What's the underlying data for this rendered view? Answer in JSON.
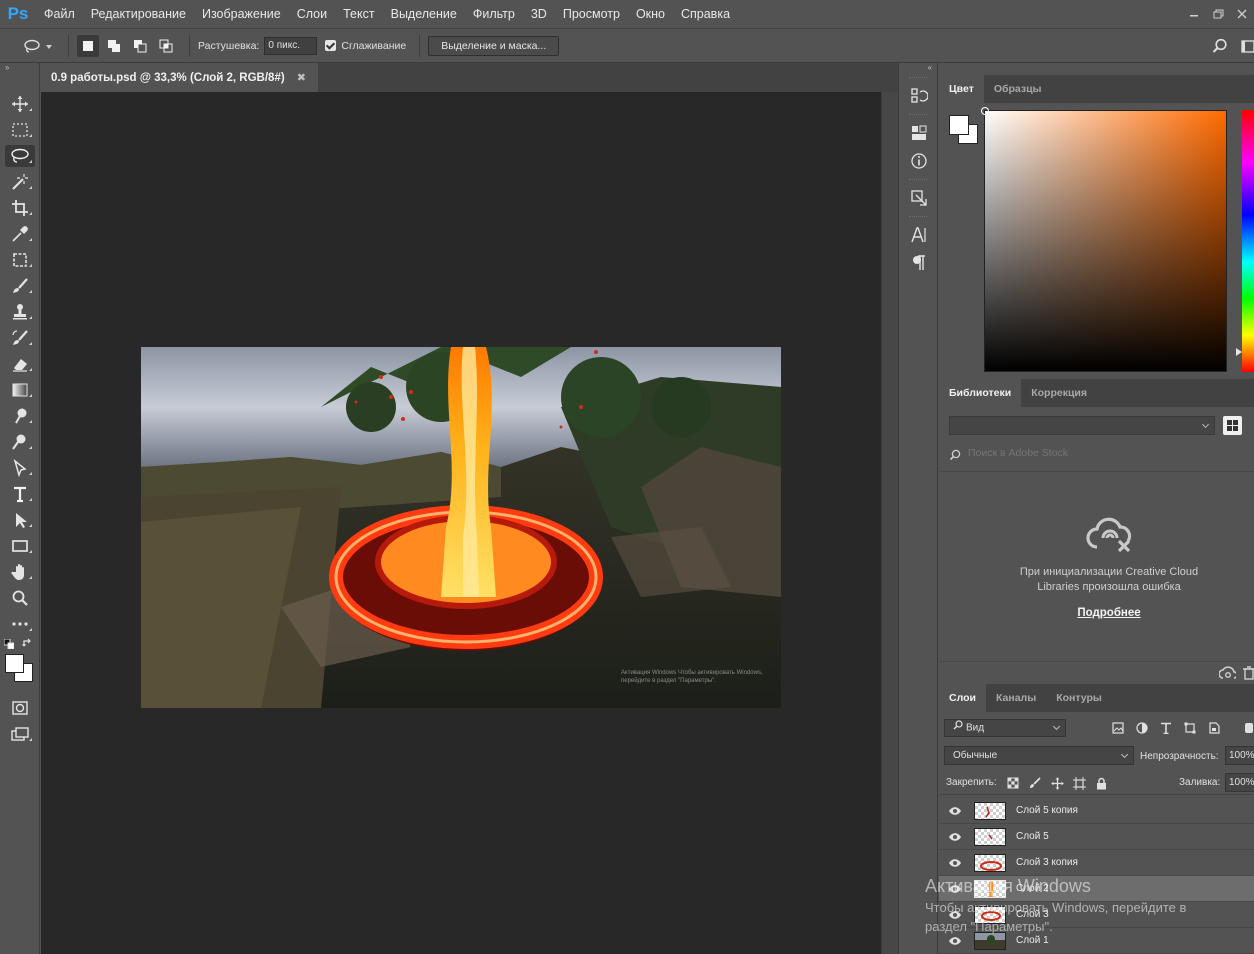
{
  "app": {
    "logo": "Ps",
    "menu": [
      "Файл",
      "Редактирование",
      "Изображение",
      "Слои",
      "Текст",
      "Выделение",
      "Фильтр",
      "3D",
      "Просмотр",
      "Окно",
      "Справка"
    ]
  },
  "options_bar": {
    "feather_label": "Растушевка:",
    "feather_value": "0 пикс.",
    "antialias_label": "Сглаживание",
    "select_mask_label": "Выделение и маска..."
  },
  "document": {
    "tab_title": "0.9 работы.psd @ 33,3% (Слой 2, RGB/8#)",
    "watermark_text": "Активация Windows Чтобы активировать Windows, перейдите в раздел \"Параметры\"."
  },
  "toolbar": {
    "tools": [
      "move-tool",
      "marquee-tool",
      "lasso-tool",
      "magic-wand-tool",
      "crop-tool",
      "eyedropper-tool",
      "frame-tool",
      "brush-tool",
      "stamp-tool",
      "history-brush-tool",
      "eraser-tool",
      "gradient-tool",
      "smudge-tool",
      "dodge-tool",
      "pen-tool",
      "type-tool",
      "path-select-tool",
      "rectangle-tool",
      "hand-tool",
      "zoom-tool",
      "more-tools"
    ],
    "active_tool": "lasso-tool",
    "fg_color": "#ffffff",
    "bg_color": "#ffffff"
  },
  "color_panel": {
    "tabs": [
      "Цвет",
      "Образцы"
    ],
    "active_tab": "Цвет",
    "hue_color": "#ff6a00"
  },
  "libraries_panel": {
    "tabs": [
      "Библиотеки",
      "Коррекция"
    ],
    "active_tab": "Библиотеки",
    "search_placeholder": "Поиск в Adobe Stock",
    "error_message": "При инициализации Creative Cloud Libraries произошла ошибка",
    "more_link": "Подробнее"
  },
  "layers_panel": {
    "tabs": [
      "Слои",
      "Каналы",
      "Контуры"
    ],
    "active_tab": "Слои",
    "kind_filter": "Вид",
    "blend_mode": "Обычные",
    "opacity_label": "Непрозрачность:",
    "opacity_value": "100%",
    "lock_label": "Закрепить:",
    "fill_label": "Заливка:",
    "fill_value": "100%",
    "layers": [
      {
        "name": "Слой 5 копия",
        "visible": true,
        "selected": false
      },
      {
        "name": "Слой 5",
        "visible": true,
        "selected": false
      },
      {
        "name": "Слой 3 копия",
        "visible": true,
        "selected": false
      },
      {
        "name": "Слой 2",
        "visible": true,
        "selected": true
      },
      {
        "name": "Слой 3",
        "visible": true,
        "selected": false
      },
      {
        "name": "Слой 1",
        "visible": true,
        "selected": false
      }
    ]
  },
  "windows_activation": {
    "title": "Активация Windows",
    "line1": "Чтобы активировать Windows, перейдите в",
    "line2": "раздел \"Параметры\"."
  }
}
